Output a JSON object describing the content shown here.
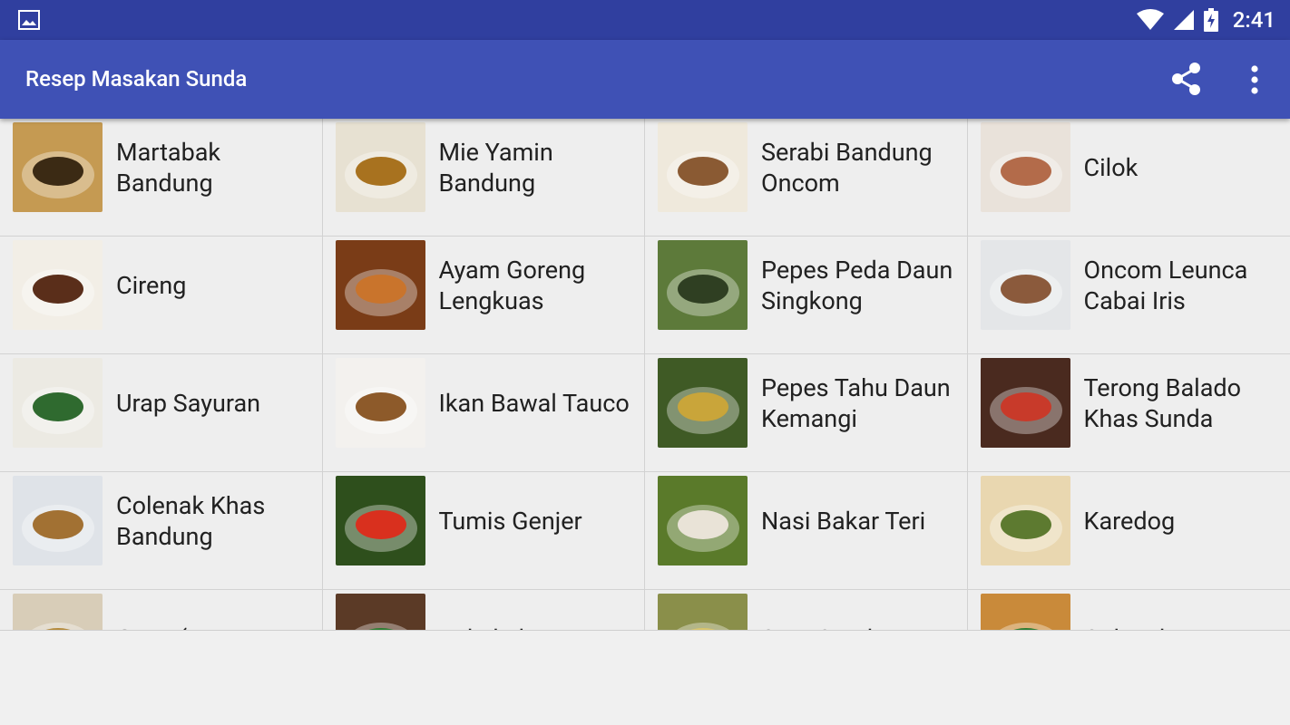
{
  "status_bar": {
    "time": "2:41",
    "icons": [
      "image-icon",
      "wifi-icon",
      "cellular-signal-icon",
      "battery-charging-icon"
    ]
  },
  "app_bar": {
    "title": "Resep Masakan Sunda",
    "actions": [
      "share-icon",
      "more-vert-icon"
    ]
  },
  "recipes": [
    {
      "name": "Martabak Bandung",
      "thumb": {
        "bg": "#c59a52",
        "accent": "#3b2a14"
      }
    },
    {
      "name": "Mie Yamin Bandung",
      "thumb": {
        "bg": "#e7e1d2",
        "accent": "#a8721f"
      }
    },
    {
      "name": "Serabi Bandung Oncom",
      "thumb": {
        "bg": "#efe9dc",
        "accent": "#8a5a33"
      }
    },
    {
      "name": "Cilok",
      "thumb": {
        "bg": "#e9e2da",
        "accent": "#b36b4a"
      }
    },
    {
      "name": "Cireng",
      "thumb": {
        "bg": "#f2eee6",
        "accent": "#5a2e1a"
      }
    },
    {
      "name": "Ayam Goreng Lengkuas",
      "thumb": {
        "bg": "#7a3c17",
        "accent": "#c9742c"
      }
    },
    {
      "name": "Pepes Peda Daun Singkong",
      "thumb": {
        "bg": "#5d7a3a",
        "accent": "#2f3f22"
      }
    },
    {
      "name": "Oncom Leunca Cabai Iris",
      "thumb": {
        "bg": "#e4e6e8",
        "accent": "#8b5a3c"
      }
    },
    {
      "name": "Urap Sayuran",
      "thumb": {
        "bg": "#eceae3",
        "accent": "#2f6a2f"
      }
    },
    {
      "name": "Ikan Bawal Tauco",
      "thumb": {
        "bg": "#f3f1ee",
        "accent": "#8d5a2a"
      }
    },
    {
      "name": "Pepes Tahu Daun Kemangi",
      "thumb": {
        "bg": "#3f5a25",
        "accent": "#c9a53a"
      }
    },
    {
      "name": "Terong Balado Khas Sunda",
      "thumb": {
        "bg": "#4a2a1f",
        "accent": "#c83a2a"
      }
    },
    {
      "name": "Colenak Khas Bandung",
      "thumb": {
        "bg": "#dfe3e8",
        "accent": "#a27133"
      }
    },
    {
      "name": "Tumis Genjer",
      "thumb": {
        "bg": "#2e4f1c",
        "accent": "#d9301e"
      }
    },
    {
      "name": "Nasi Bakar Teri",
      "thumb": {
        "bg": "#5a7a2a",
        "accent": "#e9e3d7"
      }
    },
    {
      "name": "Karedog",
      "thumb": {
        "bg": "#e9d7b0",
        "accent": "#5d7a30"
      }
    },
    {
      "name": "Geco (Tauge",
      "thumb": {
        "bg": "#d8cdb8",
        "accent": "#b58b3c"
      }
    },
    {
      "name": "Bakakak",
      "thumb": {
        "bg": "#5b3a26",
        "accent": "#2e7d32"
      }
    },
    {
      "name": "Soto Sunda",
      "thumb": {
        "bg": "#8a8f4a",
        "accent": "#d9c46a"
      }
    },
    {
      "name": "Colenak",
      "thumb": {
        "bg": "#c98a3a",
        "accent": "#2e7d32"
      }
    }
  ]
}
